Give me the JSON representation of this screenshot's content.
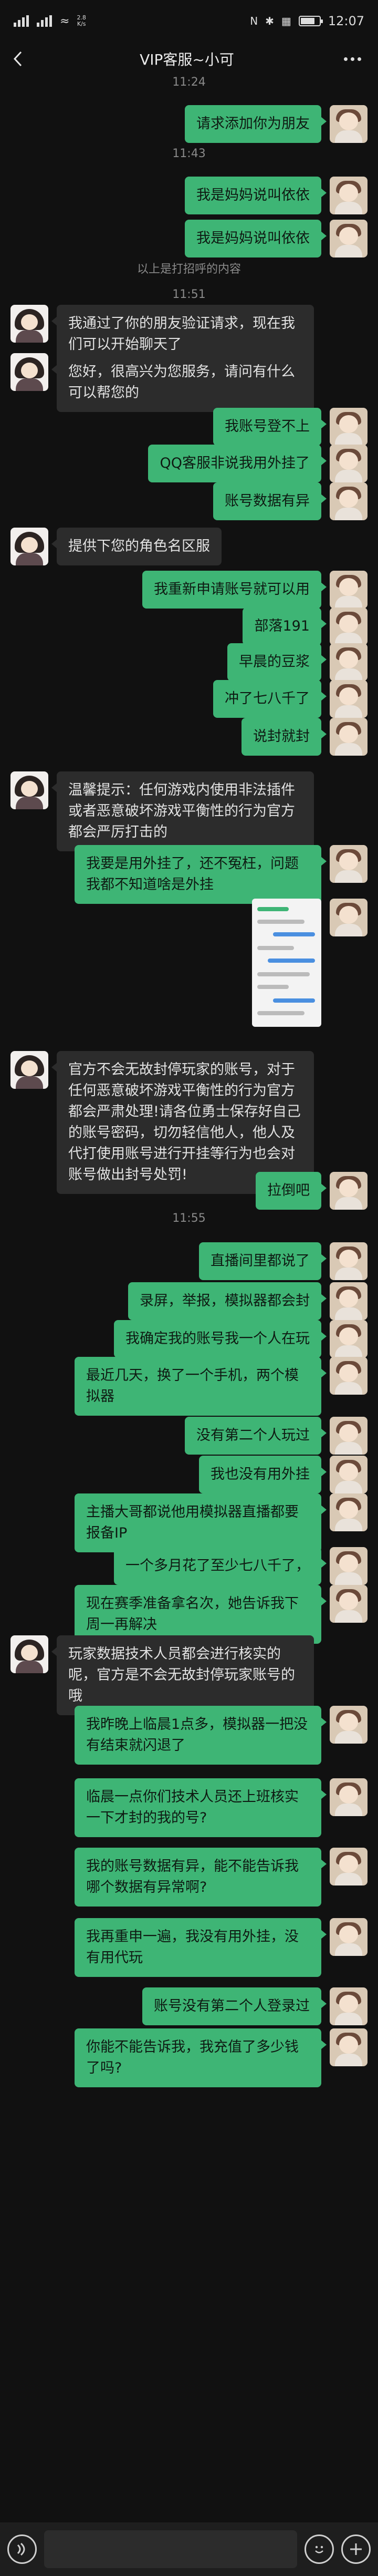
{
  "status_bar": {
    "network_top": "2.8",
    "network_bottom": "K/s",
    "time": "12:07"
  },
  "header": {
    "title": "VIP客服~小可"
  },
  "messages": [
    {
      "type": "time",
      "text": "11:24"
    },
    {
      "type": "text",
      "side": "right",
      "text": "请求添加你为朋友"
    },
    {
      "type": "time",
      "text": "11:43"
    },
    {
      "type": "text",
      "side": "right",
      "text": "我是妈妈说叫依依"
    },
    {
      "type": "text",
      "side": "right",
      "text": "我是妈妈说叫依依"
    },
    {
      "type": "system",
      "text": "以上是打招呼的内容"
    },
    {
      "type": "time",
      "text": "11:51"
    },
    {
      "type": "text",
      "side": "left",
      "text": "我通过了你的朋友验证请求，现在我们可以开始聊天了"
    },
    {
      "type": "text",
      "side": "left",
      "text": "您好，很高兴为您服务，请问有什么可以帮您的"
    },
    {
      "type": "text",
      "side": "right",
      "text": "我账号登不上"
    },
    {
      "type": "text",
      "side": "right",
      "text": "QQ客服非说我用外挂了"
    },
    {
      "type": "text",
      "side": "right",
      "text": "账号数据有异"
    },
    {
      "type": "text",
      "side": "left",
      "text": "提供下您的角色名区服"
    },
    {
      "type": "text",
      "side": "right",
      "text": "我重新申请账号就可以用"
    },
    {
      "type": "text",
      "side": "right",
      "text": "部落191"
    },
    {
      "type": "text",
      "side": "right",
      "text": "早晨的豆浆"
    },
    {
      "type": "text",
      "side": "right",
      "text": "冲了七八千了"
    },
    {
      "type": "text",
      "side": "right",
      "text": "说封就封"
    },
    {
      "type": "text",
      "side": "left",
      "text": "温馨提示：任何游戏内使用非法插件或者恶意破坏游戏平衡性的行为官方都会严厉打击的"
    },
    {
      "type": "text",
      "side": "right",
      "text": "我要是用外挂了，还不冤枉，问题我都不知道啥是外挂"
    },
    {
      "type": "image",
      "side": "right"
    },
    {
      "type": "text",
      "side": "left",
      "text": "官方不会无故封停玩家的账号，对于任何恶意破坏游戏平衡性的行为官方都会严肃处理!请各位勇士保存好自己的账号密码，切勿轻信他人，他人及代打使用账号进行开挂等行为也会对账号做出封号处罚!"
    },
    {
      "type": "text",
      "side": "right",
      "text": "拉倒吧"
    },
    {
      "type": "time",
      "text": "11:55"
    },
    {
      "type": "text",
      "side": "right",
      "text": "直播间里都说了"
    },
    {
      "type": "text",
      "side": "right",
      "text": "录屏，举报，模拟器都会封"
    },
    {
      "type": "text",
      "side": "right",
      "text": "我确定我的账号我一个人在玩"
    },
    {
      "type": "text",
      "side": "right",
      "text": "最近几天，换了一个手机，两个模拟器"
    },
    {
      "type": "text",
      "side": "right",
      "text": "没有第二个人玩过"
    },
    {
      "type": "text",
      "side": "right",
      "text": "我也没有用外挂"
    },
    {
      "type": "text",
      "side": "right",
      "text": "主播大哥都说他用模拟器直播都要报备IP"
    },
    {
      "type": "text",
      "side": "right",
      "text": "一个多月花了至少七八千了，"
    },
    {
      "type": "text",
      "side": "right",
      "text": "现在赛季准备拿名次，她告诉我下周一再解决"
    },
    {
      "type": "text",
      "side": "left",
      "text": "玩家数据技术人员都会进行核实的呢，官方是不会无故封停玩家账号的哦"
    },
    {
      "type": "text",
      "side": "right",
      "text": "我昨晚上临晨1点多，模拟器一把没有结束就闪退了"
    },
    {
      "type": "text",
      "side": "right",
      "text": "临晨一点你们技术人员还上班核实一下才封的我的号?"
    },
    {
      "type": "text",
      "side": "right",
      "text": "我的账号数据有异，能不能告诉我哪个数据有异常啊?"
    },
    {
      "type": "text",
      "side": "right",
      "text": "我再重申一遍，我没有用外挂，没有用代玩"
    },
    {
      "type": "text",
      "side": "right",
      "text": "账号没有第二个人登录过"
    },
    {
      "type": "text",
      "side": "right",
      "text": "你能不能告诉我，我充值了多少钱了吗?"
    }
  ]
}
